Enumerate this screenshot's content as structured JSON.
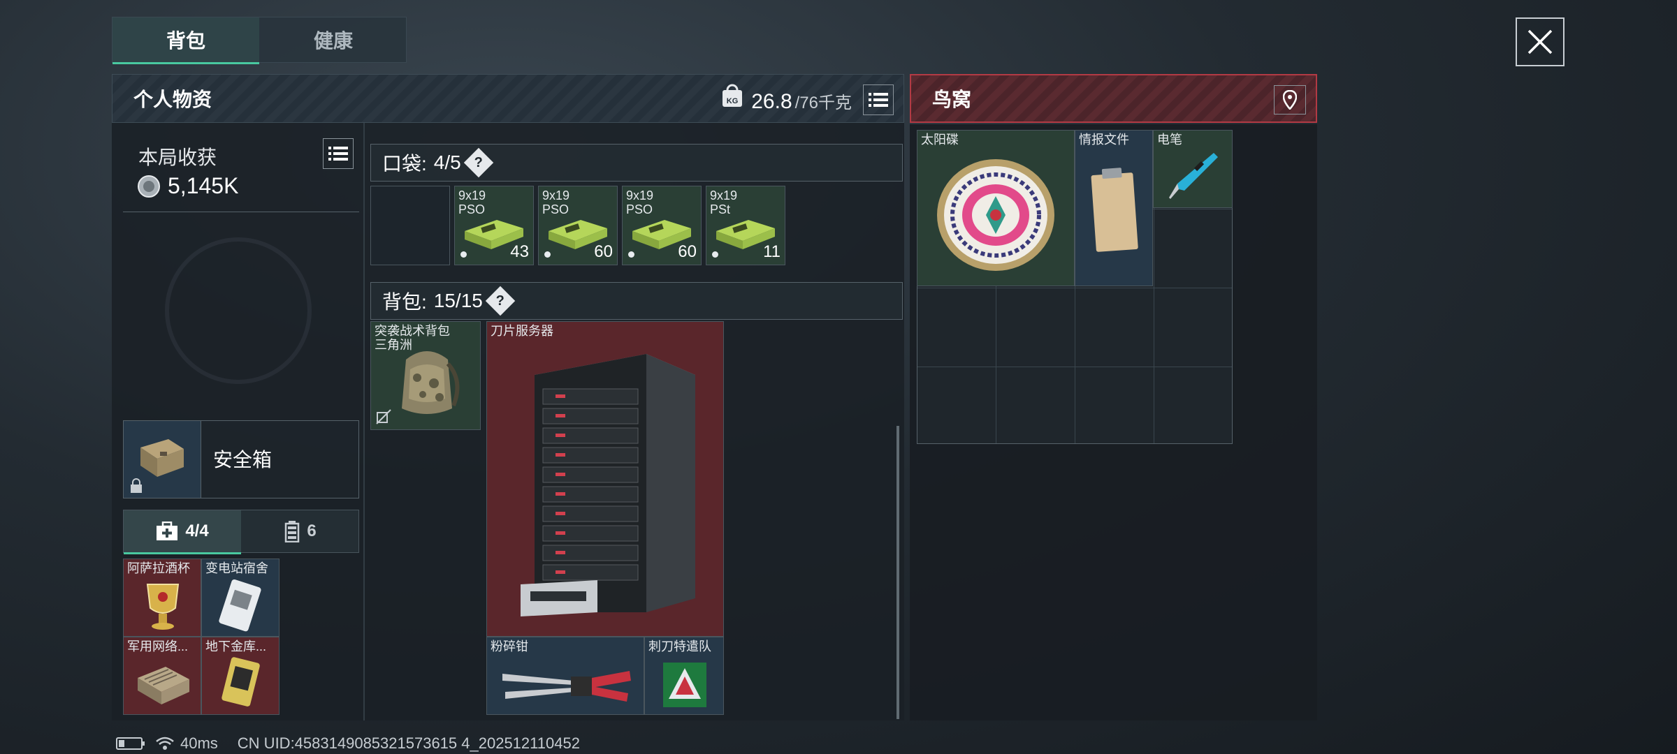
{
  "tabs": [
    {
      "label": "背包",
      "active": true
    },
    {
      "label": "健康",
      "active": false
    }
  ],
  "personal": {
    "title": "个人物资",
    "weight_current": "26.8",
    "weight_max": "/76千克",
    "weight_icon_text": "KG"
  },
  "haul": {
    "title": "本局收获",
    "value": "5,145K"
  },
  "safe_box": {
    "label": "安全箱"
  },
  "subtabs": [
    {
      "label": "4/4",
      "icon": "medkit-icon",
      "active": true
    },
    {
      "label": "6",
      "icon": "battery-icon",
      "active": false
    }
  ],
  "safe_items": [
    {
      "label": "阿萨拉酒杯"
    },
    {
      "label": "变电站宿舍"
    },
    {
      "label": "军用网络..."
    },
    {
      "label": "地下金库..."
    }
  ],
  "pockets": {
    "label": "口袋:",
    "count": "4/5",
    "ammo": [
      {
        "label": "9x19\nPSO",
        "count": "43"
      },
      {
        "label": "9x19\nPSO",
        "count": "60"
      },
      {
        "label": "9x19\nPSO",
        "count": "60"
      },
      {
        "label": "9x19\nPSt",
        "count": "11"
      }
    ]
  },
  "backpack": {
    "label": "背包:",
    "count": "15/15",
    "bag_item": "突袭战术背包\n三角洲",
    "items": [
      {
        "label": "刀片服务器"
      },
      {
        "label": "粉碎钳"
      },
      {
        "label": "刺刀特遣队"
      }
    ]
  },
  "location": {
    "title": "鸟窝",
    "items": [
      {
        "label": "太阳碟"
      },
      {
        "label": "情报文件"
      },
      {
        "label": "电笔"
      }
    ]
  },
  "status": {
    "ping": "40ms",
    "uid": "CN UID:4583149085321573615 4_202512110452"
  },
  "colors": {
    "accent": "#49c9a0",
    "location_red": "#b23a44",
    "item_green": "#2a3f35",
    "item_red": "#5a262b",
    "item_blue": "#263848"
  }
}
